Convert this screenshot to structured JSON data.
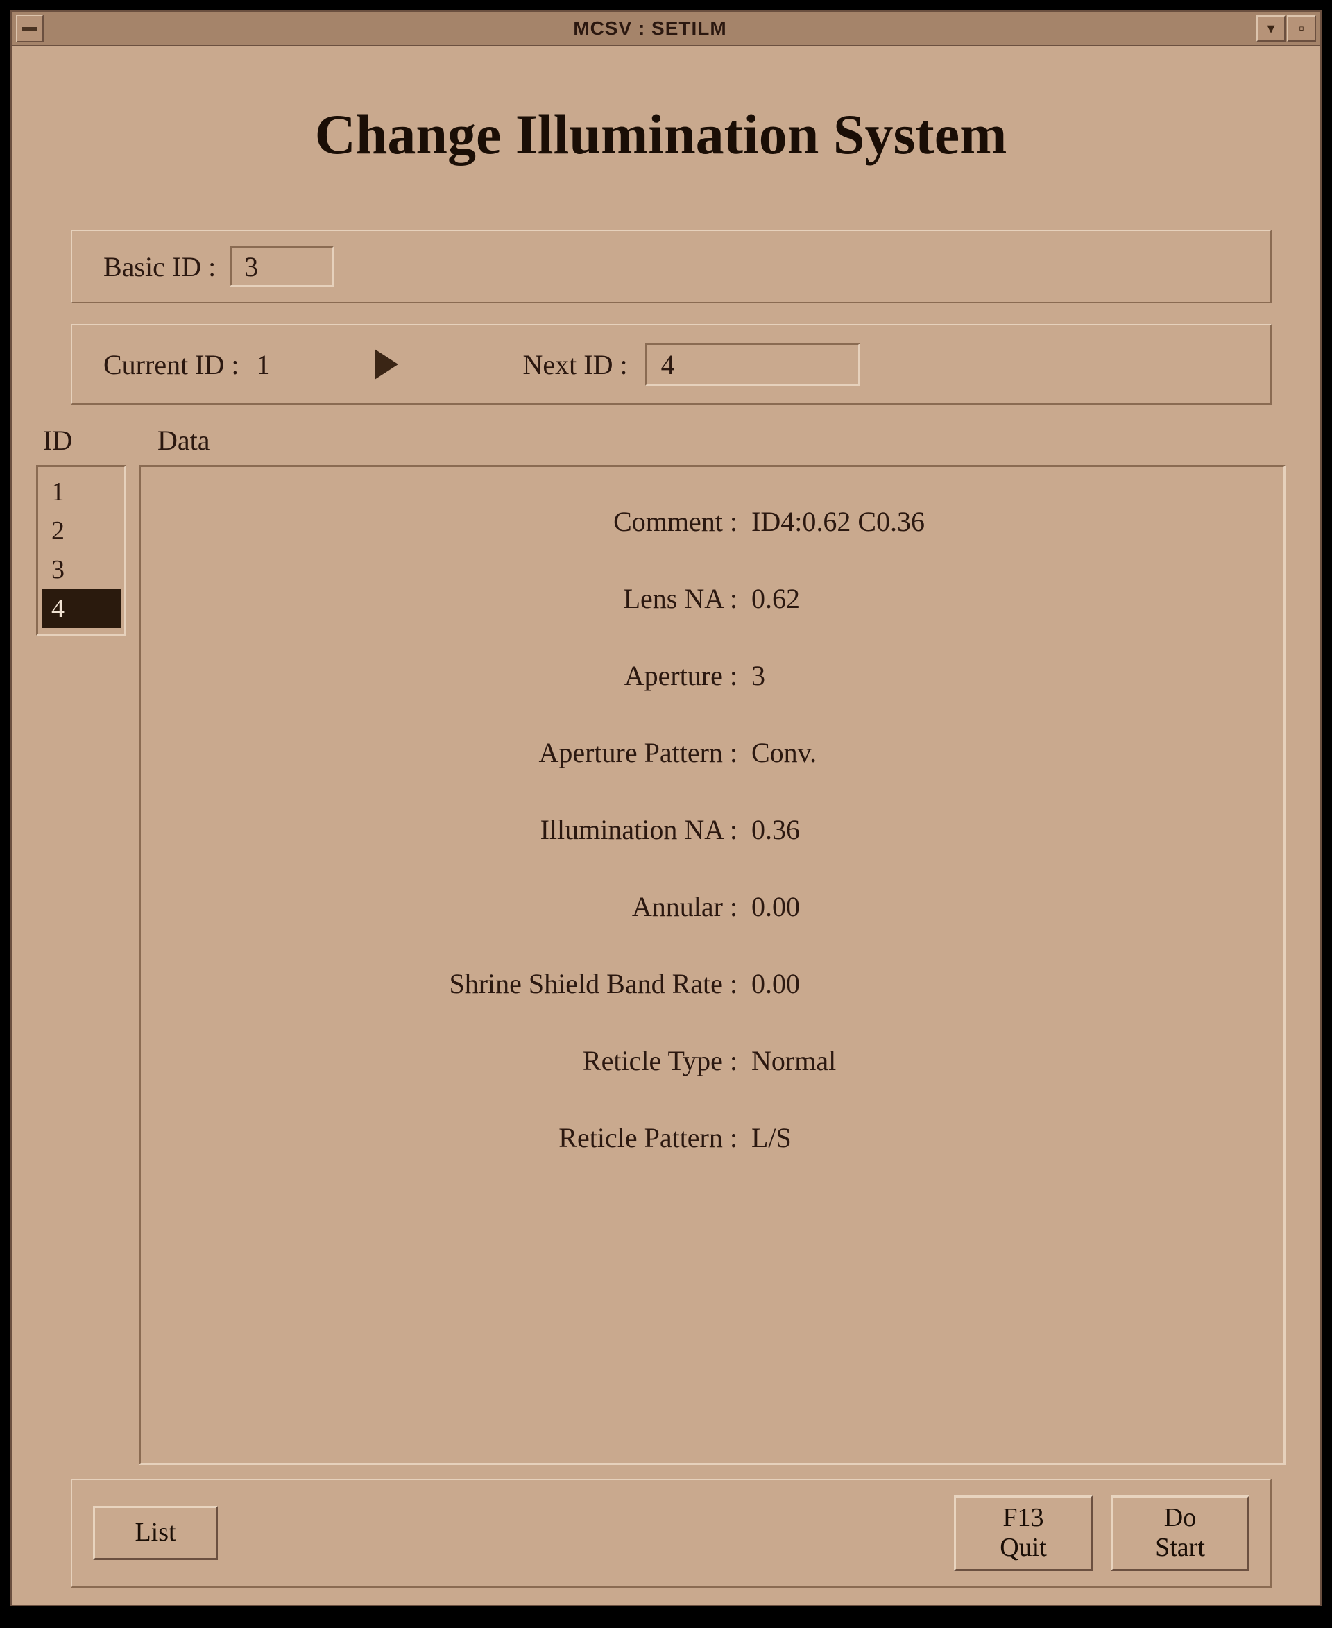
{
  "window": {
    "title": "MCSV : SETILM",
    "page_title": "Change Illumination System"
  },
  "basic_id": {
    "label": "Basic ID :",
    "value": "3"
  },
  "current": {
    "label": "Current ID :",
    "value": "1"
  },
  "next": {
    "label": "Next ID :",
    "value": "4"
  },
  "list_headers": {
    "id": "ID",
    "data": "Data"
  },
  "id_list": {
    "items": [
      {
        "id": "1",
        "selected": false
      },
      {
        "id": "2",
        "selected": false
      },
      {
        "id": "3",
        "selected": false
      },
      {
        "id": "4",
        "selected": true
      }
    ]
  },
  "data_panel": {
    "comment": {
      "label": "Comment :",
      "value": "ID4:0.62 C0.36"
    },
    "lens_na": {
      "label": "Lens NA :",
      "value": "0.62"
    },
    "aperture": {
      "label": "Aperture :",
      "value": "3"
    },
    "aperture_pattern": {
      "label": "Aperture Pattern :",
      "value": "Conv."
    },
    "illum_na": {
      "label": "Illumination NA :",
      "value": "0.36"
    },
    "annular": {
      "label": "Annular :",
      "value": "0.00"
    },
    "shrine_shield": {
      "label": "Shrine Shield Band Rate :",
      "value": "0.00"
    },
    "reticle_type": {
      "label": "Reticle Type :",
      "value": "Normal"
    },
    "reticle_pattern": {
      "label": "Reticle Pattern :",
      "value": "L/S"
    }
  },
  "buttons": {
    "list": "List",
    "quit_l1": "F13",
    "quit_l2": "Quit",
    "do_l1": "Do",
    "do_l2": "Start"
  }
}
